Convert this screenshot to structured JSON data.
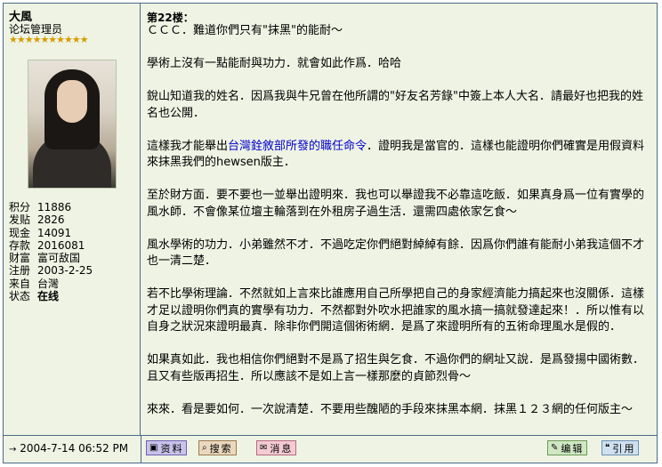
{
  "user": {
    "name": "大風",
    "role": "论坛管理员",
    "stars": "★★★★★★★★★★",
    "stats": [
      {
        "label": "积分",
        "value": "11886"
      },
      {
        "label": "发贴",
        "value": "2826"
      },
      {
        "label": "现金",
        "value": "14091"
      },
      {
        "label": "存款",
        "value": "2016081"
      },
      {
        "label": "财富",
        "value": "富可敌国"
      },
      {
        "label": "注册",
        "value": "2003-2-25"
      },
      {
        "label": "来自",
        "value": "台灣"
      },
      {
        "label": "状态",
        "value": "在线"
      }
    ]
  },
  "post": {
    "floor": "第22楼：",
    "lines": {
      "l1": "ＣＣＣ．難道你們只有\"抹黑\"的能耐～",
      "l2": "學術上沒有一點能耐與功力．就會如此作爲．哈哈",
      "l3": "銳山知道我的姓名．因爲我與牛兄曾在他所謂的\"好友名芳錄\"中簽上本人大名．請最好也把我的姓名也公開．",
      "l4a": "這樣我才能舉出",
      "l4link": "台灣銓敘部所發的職任命令",
      "l4b": "．證明我是當官的．這樣也能證明你們確實是用假資料來抹黑我們的hewsen版主．",
      "l5": "至於財方面．要不要也一並舉出證明來．我也可以舉證我不必靠這吃飯．如果真身爲一位有實學的風水師．不會像某位壇主輪落到在外租房子過生活．還需四處依家乞食～",
      "l6": "風水學術的功力．小弟雖然不才．不過吃定你們絕對綽綽有餘．因爲你們誰有能耐小弟我這個不才也一清二楚．",
      "l7": "若不比學術理論．不然就如上言來比誰應用自己所學把自己的身家經濟能力搞起來也沒關係．這樣才足以證明你們真的實學有功力．不然都對外吹水把誰家的風水搞一搞就發達起來！．所以惟有以自身之狀況來證明最真．除非你們開這個術術網．是爲了來證明所有的五術命理風水是假的．",
      "l8": "如果真如此．我也相信你們絕對不是爲了招生與乞食．不過你們的網址又說．是爲發揚中國術數．且又有些版再招生．所以應該不是如上言一樣那麼的貞節烈骨～",
      "l9": "來來．看是要如何．一次說清楚．不要用些醜陋的手段來抹黑本網．抹黑１２３網的任何版主～"
    }
  },
  "footer": {
    "time_icon": "→",
    "time": "2004-7-14 06:52 PM",
    "buttons": {
      "info": "资料",
      "search": "搜索",
      "msg": "消息",
      "edit": "编辑",
      "quote": "引用"
    }
  }
}
